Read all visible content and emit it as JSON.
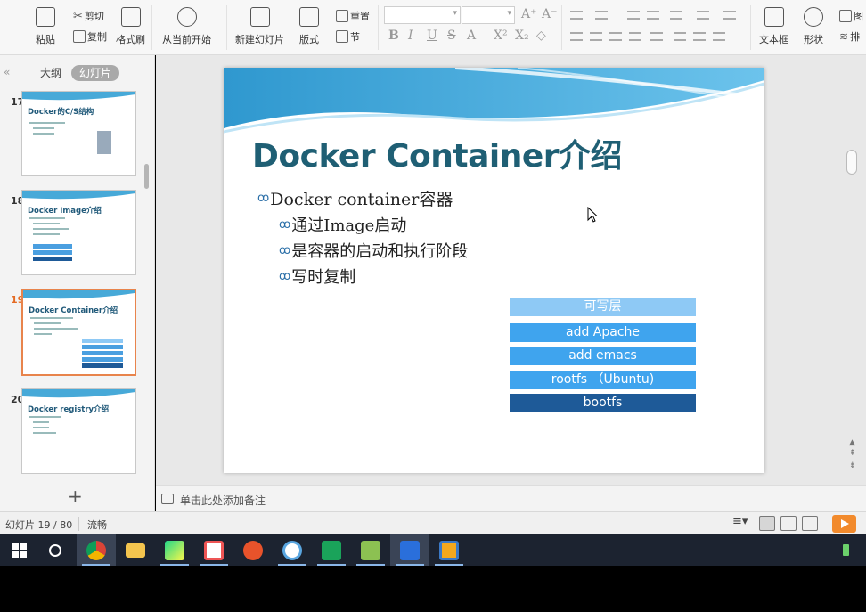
{
  "ribbon": {
    "paste": "粘贴",
    "cut": "剪切",
    "copy": "复制",
    "format_painter": "格式刷",
    "start_from_current": "从当前开始",
    "new_slide": "新建幻灯片",
    "layout": "版式",
    "reset": "重置",
    "section": "节",
    "textbox": "文本框",
    "shape": "形状",
    "picture": "图",
    "arrange": "排"
  },
  "sidebar": {
    "tab_outline": "大纲",
    "tab_slides": "幻灯片",
    "slides": [
      {
        "num": "17",
        "title": "Docker的C/S结构"
      },
      {
        "num": "18",
        "title": "Docker Image介绍"
      },
      {
        "num": "19",
        "title": "Docker Container介绍"
      },
      {
        "num": "20",
        "title": "Docker registry介绍"
      }
    ],
    "add_slide": "+"
  },
  "slide": {
    "title": "Docker Container介绍",
    "bullets": [
      "Docker container容器",
      "通过Image启动",
      "是容器的启动和执行阶段",
      "写时复制"
    ],
    "bullet_mark": "ꝏ",
    "layers": [
      {
        "label": "可写层",
        "color": "#8ec9f5"
      },
      {
        "label": "add Apache",
        "color": "#3fa4ee"
      },
      {
        "label": "add emacs",
        "color": "#3fa4ee"
      },
      {
        "label": "rootfs （Ubuntu)",
        "color": "#3fa4ee"
      },
      {
        "label": "bootfs",
        "color": "#1e5a98"
      }
    ]
  },
  "notes": {
    "placeholder": "单击此处添加备注"
  },
  "status": {
    "slide_counter": "幻灯片 19 / 80",
    "theme": "流畅"
  },
  "colors": {
    "title": "#1f5f74",
    "accent_orange": "#f28a2c",
    "taskbar": "#1c2330"
  },
  "taskbar": {
    "apps": [
      "windows-start",
      "cortana",
      "chrome",
      "file-explorer",
      "pycharm",
      "media-player",
      "swirl-app",
      "avatar-app",
      "wps-spreadsheet",
      "notepad",
      "wps-office",
      "vmware"
    ]
  }
}
